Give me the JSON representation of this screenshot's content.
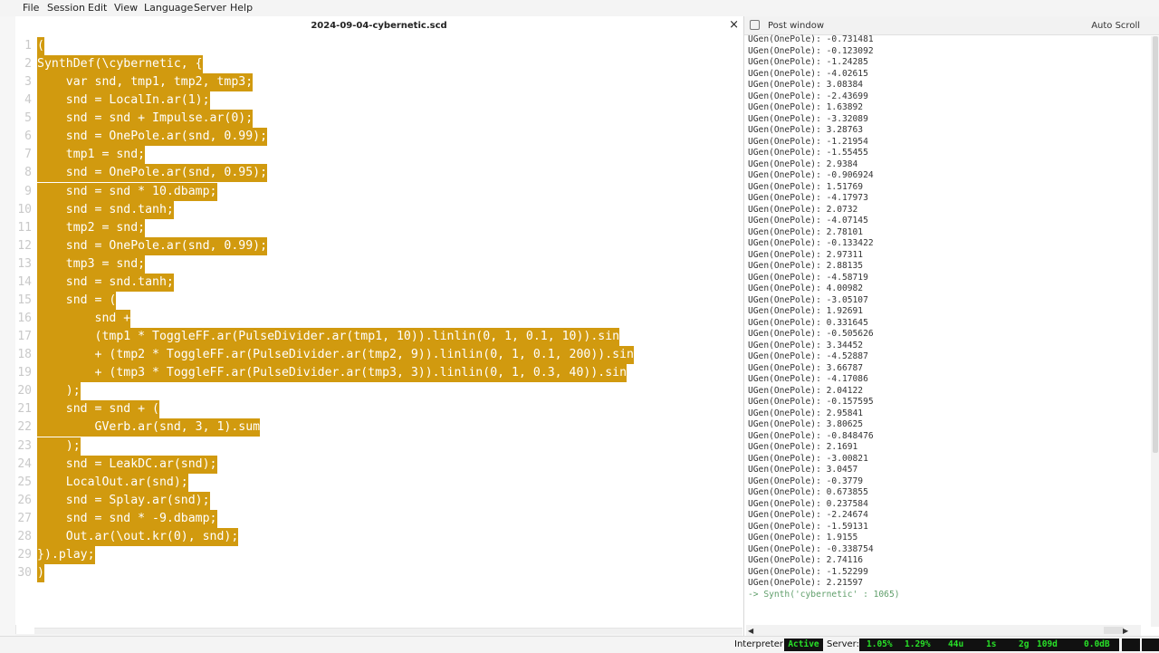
{
  "menu": [
    "File",
    "Session",
    "Edit",
    "View",
    "Language",
    "Server",
    "Help"
  ],
  "editor": {
    "filename": "2024-09-04-cybernetic.scd",
    "close_symbol": "×",
    "lines": [
      {
        "n": "1",
        "text": "("
      },
      {
        "n": "2",
        "text": "SynthDef(\\cybernetic, {"
      },
      {
        "n": "3",
        "text": "    var snd, tmp1, tmp2, tmp3;"
      },
      {
        "n": "4",
        "text": "    snd = LocalIn.ar(1);"
      },
      {
        "n": "5",
        "text": "    snd = snd + Impulse.ar(0);"
      },
      {
        "n": "6",
        "text": "    snd = OnePole.ar(snd, 0.99);"
      },
      {
        "n": "7",
        "text": "    tmp1 = snd;"
      },
      {
        "n": "8",
        "text": "    snd = OnePole.ar(snd, 0.95);"
      },
      {
        "n": "9",
        "text": "    snd = snd * 10.dbamp;"
      },
      {
        "n": "10",
        "text": "    snd = snd.tanh;"
      },
      {
        "n": "11",
        "text": "    tmp2 = snd;"
      },
      {
        "n": "12",
        "text": "    snd = OnePole.ar(snd, 0.99);"
      },
      {
        "n": "13",
        "text": "    tmp3 = snd;"
      },
      {
        "n": "14",
        "text": "    snd = snd.tanh;"
      },
      {
        "n": "15",
        "text": "    snd = ("
      },
      {
        "n": "16",
        "text": "        snd +"
      },
      {
        "n": "17",
        "text": "        (tmp1 * ToggleFF.ar(PulseDivider.ar(tmp1, 10)).linlin(0, 1, 0.1, 10)).sin"
      },
      {
        "n": "18",
        "text": "        + (tmp2 * ToggleFF.ar(PulseDivider.ar(tmp2, 9)).linlin(0, 1, 0.1, 200)).sin"
      },
      {
        "n": "19",
        "text": "        + (tmp3 * ToggleFF.ar(PulseDivider.ar(tmp3, 3)).linlin(0, 1, 0.3, 40)).sin"
      },
      {
        "n": "20",
        "text": "    );"
      },
      {
        "n": "21",
        "text": "    snd = snd + ("
      },
      {
        "n": "22",
        "text": "        GVerb.ar(snd, 3, 1).sum"
      },
      {
        "n": "23",
        "text": "    );"
      },
      {
        "n": "24",
        "text": "    snd = LeakDC.ar(snd);"
      },
      {
        "n": "25",
        "text": "    LocalOut.ar(snd);"
      },
      {
        "n": "26",
        "text": "    snd = Splay.ar(snd);"
      },
      {
        "n": "27",
        "text": "    snd = snd * -9.dbamp;"
      },
      {
        "n": "28",
        "text": "    Out.ar(\\out.kr(0), snd);"
      },
      {
        "n": "29",
        "text": "}).play;"
      },
      {
        "n": "30",
        "text": ")"
      }
    ]
  },
  "post": {
    "title": "Post window",
    "autoscroll": "Auto Scroll",
    "lines": [
      "UGen(OnePole): -0.731481",
      "UGen(OnePole): -0.123092",
      "UGen(OnePole): -1.24285",
      "UGen(OnePole): -4.02615",
      "UGen(OnePole): 3.08384",
      "UGen(OnePole): -2.43699",
      "UGen(OnePole): 1.63892",
      "UGen(OnePole): -3.32089",
      "UGen(OnePole): 3.28763",
      "UGen(OnePole): -1.21954",
      "UGen(OnePole): -1.55455",
      "UGen(OnePole): 2.9384",
      "UGen(OnePole): -0.906924",
      "UGen(OnePole): 1.51769",
      "UGen(OnePole): -4.17973",
      "UGen(OnePole): 2.0732",
      "UGen(OnePole): -4.07145",
      "UGen(OnePole): 2.78101",
      "UGen(OnePole): -0.133422",
      "UGen(OnePole): 2.97311",
      "UGen(OnePole): 2.88135",
      "UGen(OnePole): -4.58719",
      "UGen(OnePole): 4.00982",
      "UGen(OnePole): -3.05107",
      "UGen(OnePole): 1.92691",
      "UGen(OnePole): 0.331645",
      "UGen(OnePole): -0.505626",
      "UGen(OnePole): 3.34452",
      "UGen(OnePole): -4.52887",
      "UGen(OnePole): 3.66787",
      "UGen(OnePole): -4.17086",
      "UGen(OnePole): 2.04122",
      "UGen(OnePole): -0.157595",
      "UGen(OnePole): 2.95841",
      "UGen(OnePole): 3.80625",
      "UGen(OnePole): -0.848476",
      "UGen(OnePole): 2.1691",
      "UGen(OnePole): -3.00821",
      "UGen(OnePole): 3.0457",
      "UGen(OnePole): -0.3779",
      "UGen(OnePole): 0.673855",
      "UGen(OnePole): 0.237584",
      "UGen(OnePole): -2.24674",
      "UGen(OnePole): -1.59131",
      "UGen(OnePole): 1.9155",
      "UGen(OnePole): -0.338754",
      "UGen(OnePole): 2.74116",
      "UGen(OnePole): -1.52299",
      "UGen(OnePole): 2.21597"
    ],
    "result": "-> Synth('cybernetic' : 1065)"
  },
  "status": {
    "interpreter_label": "Interpreter:",
    "interpreter_state": "Active",
    "server_label": "Server:",
    "avg_cpu": "1.05%",
    "peak_cpu": "1.29%",
    "ugens": "44u",
    "synths": "1s",
    "groups": "2g",
    "synthdefs": "109d",
    "volume": "0.0dB"
  },
  "colors": {
    "selection": "#d19a0f",
    "status_green": "#28e028",
    "status_bg": "#111111",
    "result_green": "#5f9e6a"
  }
}
